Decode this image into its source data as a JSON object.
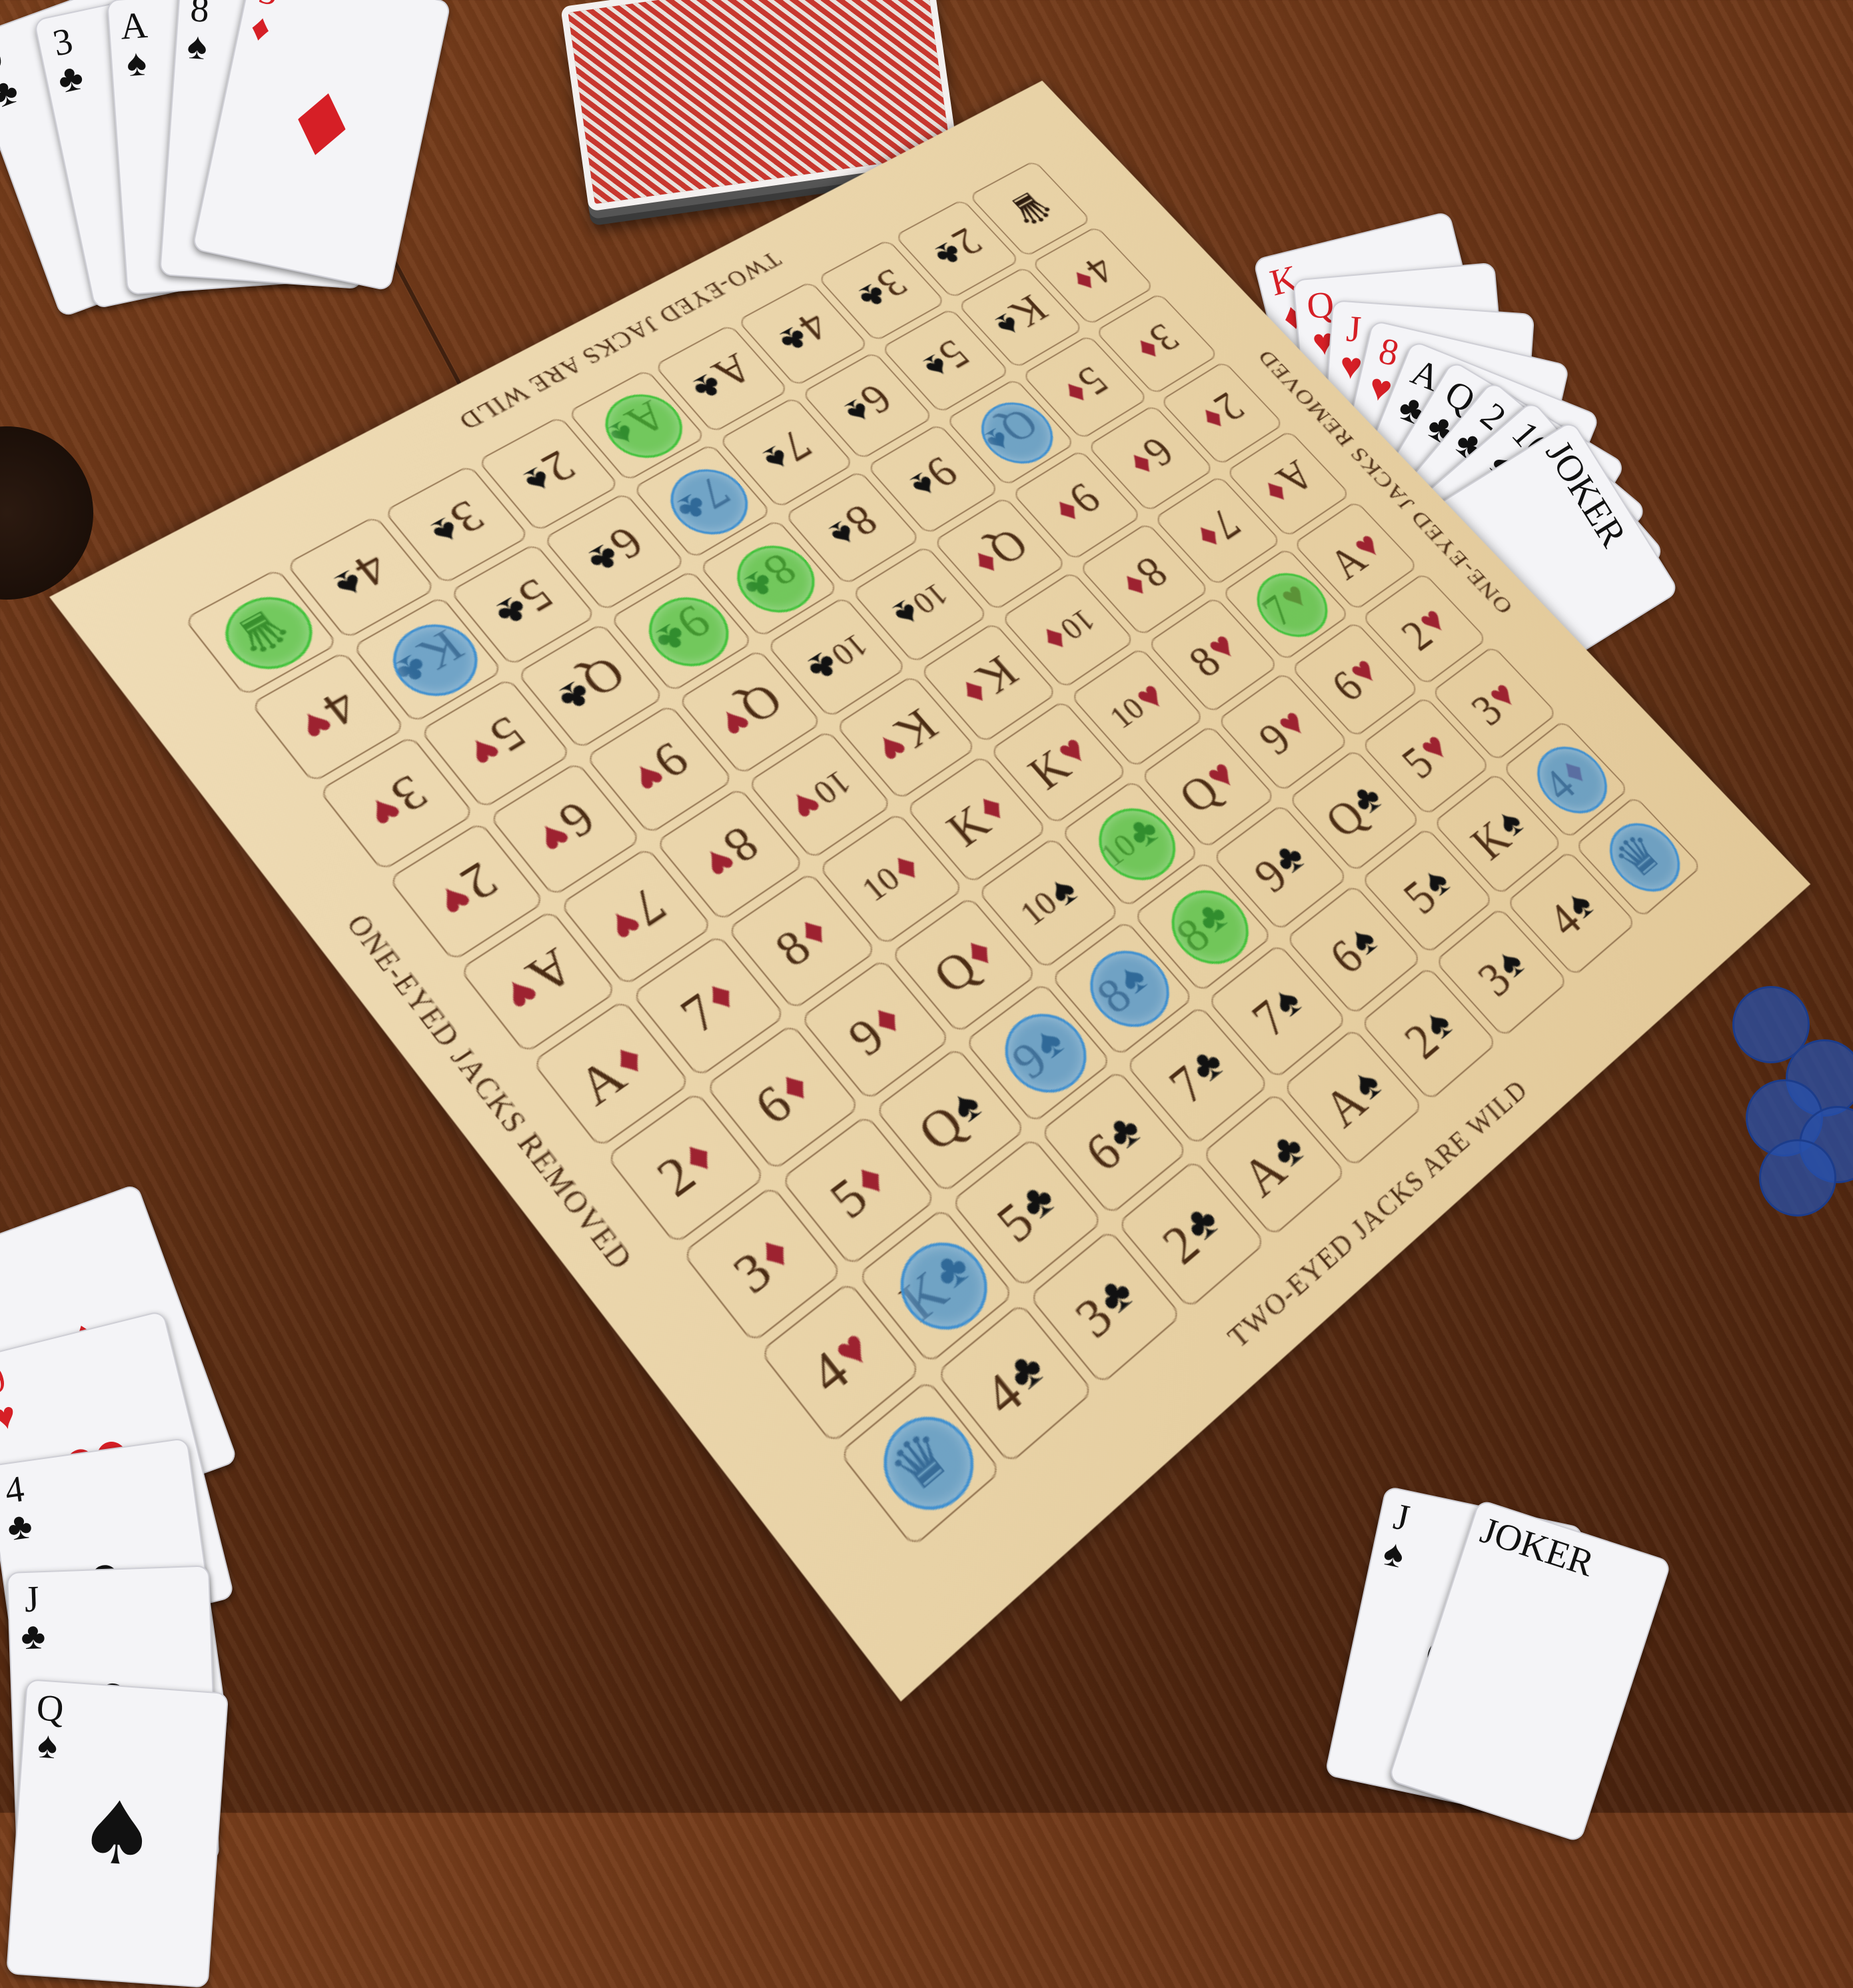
{
  "board": {
    "edge_text": {
      "top": "TWO-EYED JACKS ARE WILD",
      "bottom": "TWO-EYED JACKS ARE WILD",
      "left": "ONE-EYED JACKS REMOVED",
      "right": "ONE-EYED JACKS REMOVED"
    },
    "chip_colors": {
      "green": "#3fc23a",
      "blue": "#3d8fd1"
    },
    "rows": [
      [
        {
          "joker": true
        },
        {
          "r": "2",
          "s": "♣"
        },
        {
          "r": "3",
          "s": "♣"
        },
        {
          "r": "4",
          "s": "♣"
        },
        {
          "r": "A",
          "s": "♣"
        },
        {
          "r": "A",
          "s": "♠",
          "chip": "green"
        },
        {
          "r": "2",
          "s": "♠"
        },
        {
          "r": "3",
          "s": "♠"
        },
        {
          "r": "4",
          "s": "♠"
        },
        {
          "joker": true,
          "chip": "green"
        }
      ],
      [
        {
          "r": "4",
          "s": "♦"
        },
        {
          "r": "K",
          "s": "♠"
        },
        {
          "r": "5",
          "s": "♠"
        },
        {
          "r": "6",
          "s": "♠"
        },
        {
          "r": "7",
          "s": "♠"
        },
        {
          "r": "7",
          "s": "♣",
          "chip": "blue"
        },
        {
          "r": "6",
          "s": "♣"
        },
        {
          "r": "5",
          "s": "♣"
        },
        {
          "r": "K",
          "s": "♣",
          "chip": "blue"
        },
        {
          "r": "4",
          "s": "♥"
        }
      ],
      [
        {
          "r": "3",
          "s": "♦"
        },
        {
          "r": "5",
          "s": "♦"
        },
        {
          "r": "Q",
          "s": "♠",
          "chip": "blue"
        },
        {
          "r": "9",
          "s": "♠"
        },
        {
          "r": "8",
          "s": "♠"
        },
        {
          "r": "8",
          "s": "♣",
          "chip": "green"
        },
        {
          "r": "9",
          "s": "♣",
          "chip": "green"
        },
        {
          "r": "Q",
          "s": "♣"
        },
        {
          "r": "5",
          "s": "♥"
        },
        {
          "r": "3",
          "s": "♥"
        }
      ],
      [
        {
          "r": "2",
          "s": "♦"
        },
        {
          "r": "6",
          "s": "♦"
        },
        {
          "r": "9",
          "s": "♦"
        },
        {
          "r": "Q",
          "s": "♦"
        },
        {
          "r": "10",
          "s": "♠"
        },
        {
          "r": "10",
          "s": "♣"
        },
        {
          "r": "Q",
          "s": "♥"
        },
        {
          "r": "9",
          "s": "♥"
        },
        {
          "r": "6",
          "s": "♥"
        },
        {
          "r": "2",
          "s": "♥"
        }
      ],
      [
        {
          "r": "A",
          "s": "♦"
        },
        {
          "r": "7",
          "s": "♦"
        },
        {
          "r": "8",
          "s": "♦"
        },
        {
          "r": "10",
          "s": "♦"
        },
        {
          "r": "K",
          "s": "♦"
        },
        {
          "r": "K",
          "s": "♥"
        },
        {
          "r": "10",
          "s": "♥"
        },
        {
          "r": "8",
          "s": "♥"
        },
        {
          "r": "7",
          "s": "♥"
        },
        {
          "r": "A",
          "s": "♥"
        }
      ],
      [
        {
          "r": "A",
          "s": "♥"
        },
        {
          "r": "7",
          "s": "♥",
          "chip": "green"
        },
        {
          "r": "8",
          "s": "♥"
        },
        {
          "r": "10",
          "s": "♥"
        },
        {
          "r": "K",
          "s": "♥"
        },
        {
          "r": "K",
          "s": "♦"
        },
        {
          "r": "10",
          "s": "♦"
        },
        {
          "r": "8",
          "s": "♦"
        },
        {
          "r": "7",
          "s": "♦"
        },
        {
          "r": "A",
          "s": "♦"
        }
      ],
      [
        {
          "r": "2",
          "s": "♥"
        },
        {
          "r": "6",
          "s": "♥"
        },
        {
          "r": "9",
          "s": "♥"
        },
        {
          "r": "Q",
          "s": "♥"
        },
        {
          "r": "10",
          "s": "♣",
          "chip": "green"
        },
        {
          "r": "10",
          "s": "♠"
        },
        {
          "r": "Q",
          "s": "♦"
        },
        {
          "r": "9",
          "s": "♦"
        },
        {
          "r": "6",
          "s": "♦"
        },
        {
          "r": "2",
          "s": "♦"
        }
      ],
      [
        {
          "r": "3",
          "s": "♥"
        },
        {
          "r": "5",
          "s": "♥"
        },
        {
          "r": "Q",
          "s": "♣"
        },
        {
          "r": "9",
          "s": "♣"
        },
        {
          "r": "8",
          "s": "♣",
          "chip": "green"
        },
        {
          "r": "8",
          "s": "♠",
          "chip": "blue"
        },
        {
          "r": "9",
          "s": "♠",
          "chip": "blue"
        },
        {
          "r": "Q",
          "s": "♠"
        },
        {
          "r": "5",
          "s": "♦"
        },
        {
          "r": "3",
          "s": "♦"
        }
      ],
      [
        {
          "r": "4",
          "s": "♦",
          "chip": "blue"
        },
        {
          "r": "K",
          "s": "♠"
        },
        {
          "r": "5",
          "s": "♠"
        },
        {
          "r": "6",
          "s": "♠"
        },
        {
          "r": "7",
          "s": "♠"
        },
        {
          "r": "7",
          "s": "♣"
        },
        {
          "r": "6",
          "s": "♣"
        },
        {
          "r": "5",
          "s": "♣"
        },
        {
          "r": "K",
          "s": "♣",
          "chip": "blue"
        },
        {
          "r": "4",
          "s": "♥"
        }
      ],
      [
        {
          "joker": true,
          "chip": "blue"
        },
        {
          "r": "4",
          "s": "♠"
        },
        {
          "r": "3",
          "s": "♠"
        },
        {
          "r": "2",
          "s": "♠"
        },
        {
          "r": "A",
          "s": "♠"
        },
        {
          "r": "A",
          "s": "♣"
        },
        {
          "r": "2",
          "s": "♣"
        },
        {
          "r": "3",
          "s": "♣"
        },
        {
          "r": "4",
          "s": "♣"
        },
        {
          "joker": true,
          "chip": "blue"
        }
      ]
    ]
  },
  "hands": {
    "top_left": [
      {
        "r": "9",
        "s": "♣"
      },
      {
        "r": "3",
        "s": "♣"
      },
      {
        "r": "A",
        "s": "♠"
      },
      {
        "r": "8",
        "s": "♠"
      },
      {
        "r": "5",
        "s": "♦"
      }
    ],
    "right": [
      {
        "r": "K",
        "s": "♦"
      },
      {
        "r": "Q",
        "s": "♥"
      },
      {
        "r": "J",
        "s": "♥"
      },
      {
        "r": "8",
        "s": "♥"
      },
      {
        "r": "A",
        "s": "♣"
      },
      {
        "r": "Q",
        "s": "♣"
      },
      {
        "r": "2",
        "s": "♣"
      },
      {
        "r": "10",
        "s": "♠"
      },
      {
        "r": "JOKER",
        "s": ""
      }
    ],
    "bottom_left": [
      {
        "r": "5",
        "s": "♦"
      },
      {
        "r": "9",
        "s": "♥"
      },
      {
        "r": "4",
        "s": "♣"
      },
      {
        "r": "J",
        "s": "♣"
      },
      {
        "r": "Q",
        "s": "♠"
      }
    ],
    "bottom_right": [
      {
        "r": "J",
        "s": "♠"
      },
      {
        "r": "JOKER",
        "s": ""
      }
    ]
  }
}
